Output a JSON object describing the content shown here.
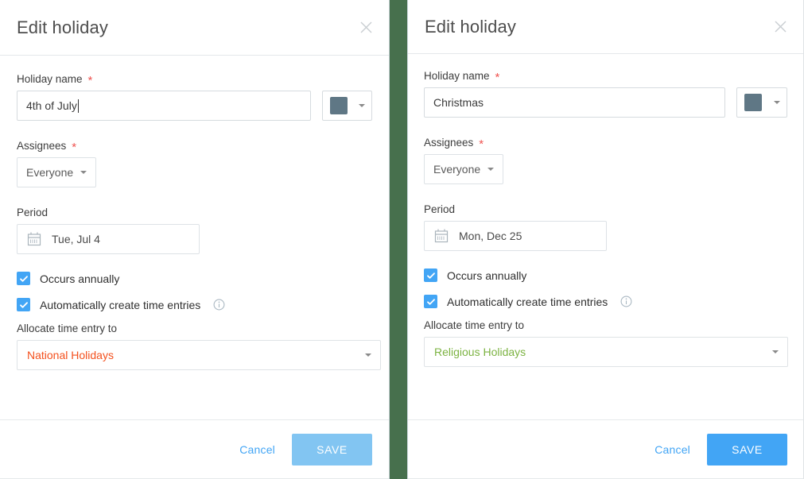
{
  "separator": {
    "color": "#47704d"
  },
  "theme": {
    "accent_blue": "#42a5f5",
    "save_muted_blue": "#82c5f2",
    "required_red": "#ef5350",
    "swatch_gray_blue": "#5f7785"
  },
  "dialogs": [
    {
      "id": "left",
      "title": "Edit holiday",
      "close_icon": "close-icon",
      "holiday_name": {
        "label": "Holiday name",
        "required_marker": "*",
        "value": "4th of July",
        "placeholder": "Holiday name",
        "has_caret": true
      },
      "color": {
        "swatch_hex": "#5f7785",
        "caret_icon": "chevron-down-icon"
      },
      "assignees": {
        "label": "Assignees",
        "required_marker": "*",
        "value": "Everyone",
        "caret_icon": "chevron-down-icon"
      },
      "period": {
        "label": "Period",
        "value": "Tue, Jul 4",
        "icon": "calendar-icon"
      },
      "occurs_annually": {
        "label": "Occurs annually",
        "checked": true
      },
      "auto_time_entries": {
        "label": "Automatically create time entries",
        "checked": true,
        "info_icon": "info-icon"
      },
      "allocate": {
        "label": "Allocate time entry to",
        "value": "National Holidays",
        "value_color": "#f4511e",
        "caret_icon": "chevron-down-icon"
      },
      "footer": {
        "cancel_label": "Cancel",
        "save_label": "SAVE",
        "save_state": "muted"
      }
    },
    {
      "id": "right",
      "title": "Edit holiday",
      "close_icon": "close-icon",
      "holiday_name": {
        "label": "Holiday name",
        "required_marker": "*",
        "value": "Christmas",
        "placeholder": "Holiday name",
        "has_caret": false
      },
      "color": {
        "swatch_hex": "#5f7785",
        "caret_icon": "chevron-down-icon"
      },
      "assignees": {
        "label": "Assignees",
        "required_marker": "*",
        "value": "Everyone",
        "caret_icon": "chevron-down-icon"
      },
      "period": {
        "label": "Period",
        "value": "Mon, Dec 25",
        "icon": "calendar-icon"
      },
      "occurs_annually": {
        "label": "Occurs annually",
        "checked": true
      },
      "auto_time_entries": {
        "label": "Automatically create time entries",
        "checked": true,
        "info_icon": "info-icon"
      },
      "allocate": {
        "label": "Allocate time entry to",
        "value": "Religious Holidays",
        "value_color": "#7cb342",
        "caret_icon": "chevron-down-icon"
      },
      "footer": {
        "cancel_label": "Cancel",
        "save_label": "SAVE",
        "save_state": "solid"
      }
    }
  ]
}
